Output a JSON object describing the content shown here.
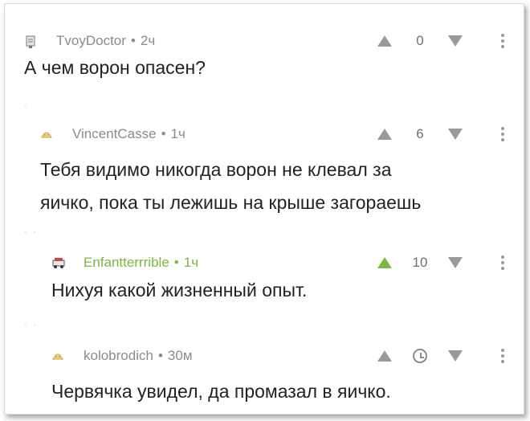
{
  "comments": [
    {
      "author": "TvoyDoctor",
      "time": "2ч",
      "score": "0",
      "text_lines": [
        "А чем ворон опасен?"
      ],
      "author_color": "#8b8b8b",
      "upvoted": false
    },
    {
      "author": "VincentCasse",
      "time": "1ч",
      "score": "6",
      "text_lines": [
        "Тебя видимо никогда ворон не клевал за",
        "яичко, пока ты лежишь на крыше загораешь"
      ],
      "author_color": "#8b8b8b",
      "upvoted": false
    },
    {
      "author": "Enfantterrrible",
      "time": "1ч",
      "score": "10",
      "text_lines": [
        "Нихуя какой жизненный опыт."
      ],
      "author_color": "#7fb640",
      "upvoted": true
    },
    {
      "author": "kolobrodich",
      "time": "30м",
      "score_icon": "clock-icon",
      "text_lines": [
        "Червячка увидел, да промазал в яичко."
      ],
      "author_color": "#8b8b8b",
      "upvoted": false
    }
  ],
  "separator": "•",
  "accent_green": "#7fb640"
}
